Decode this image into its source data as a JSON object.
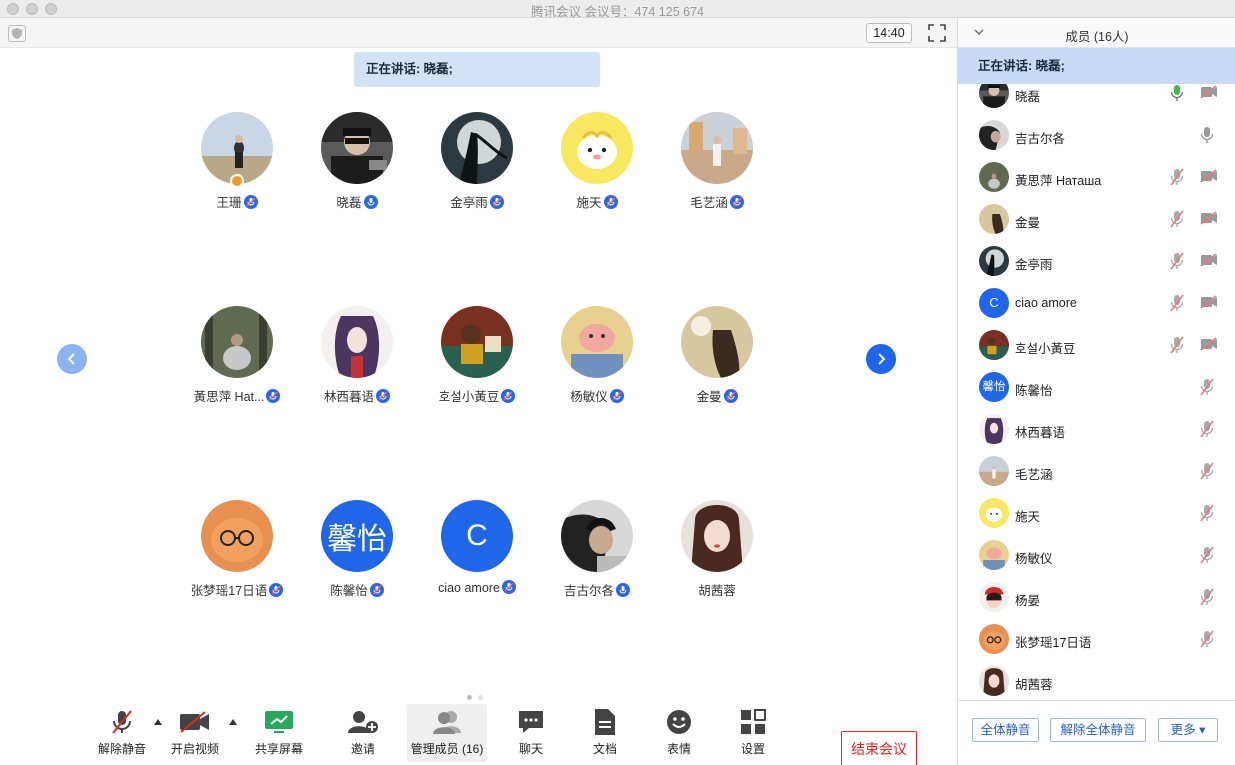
{
  "window": {
    "title": "腾讯会议 会议号：474 125 674"
  },
  "topbar": {
    "timer": "14:40"
  },
  "speaking": {
    "label": "正在讲话: 晓磊;"
  },
  "grid": {
    "participants": [
      {
        "name": "王珊",
        "host": true
      },
      {
        "name": "晓磊"
      },
      {
        "name": "金亭雨"
      },
      {
        "name": "施天"
      },
      {
        "name": "毛艺涵"
      },
      {
        "name": "黃思萍 Hat..."
      },
      {
        "name": "林西暮语"
      },
      {
        "name": "호설小黃豆"
      },
      {
        "name": "杨敏仪"
      },
      {
        "name": "金曼"
      },
      {
        "name": "张梦瑶17日语"
      },
      {
        "name": "陈馨怡",
        "initials": "馨怡"
      },
      {
        "name": "ciao amore",
        "initials": "C"
      },
      {
        "name": "吉古尔各"
      },
      {
        "name": "胡茜蓉"
      }
    ]
  },
  "toolbar": {
    "unmute": "解除静音",
    "start_video": "开启视频",
    "share_screen": "共享屏幕",
    "invite": "邀请",
    "manage_members": "管理成员 (16)",
    "chat": "聊天",
    "docs": "文档",
    "emoji": "表情",
    "settings": "设置",
    "end_meeting": "结束会议"
  },
  "panel": {
    "title": "成员 (16人)",
    "speaking": "正在讲话: 晓磊;",
    "members": [
      {
        "name": "晓磊",
        "mic": "on",
        "cam": "off"
      },
      {
        "name": "吉古尔各",
        "mic": "on-gray"
      },
      {
        "name": "黃思萍 Наташа",
        "mic": "muted",
        "cam": "off"
      },
      {
        "name": "金曼",
        "mic": "muted",
        "cam": "off"
      },
      {
        "name": "金亭雨",
        "mic": "muted",
        "cam": "off"
      },
      {
        "name": "ciao amore",
        "mic": "muted",
        "cam": "off",
        "initials": "C"
      },
      {
        "name": "호설小黃豆",
        "mic": "muted",
        "cam": "off"
      },
      {
        "name": "陈馨怡",
        "mic": "muted",
        "initials": "馨怡"
      },
      {
        "name": "林西暮语",
        "mic": "muted"
      },
      {
        "name": "毛艺涵",
        "mic": "muted"
      },
      {
        "name": "施天",
        "mic": "muted"
      },
      {
        "name": "杨敏仪",
        "mic": "muted"
      },
      {
        "name": "杨晏",
        "mic": "muted"
      },
      {
        "name": "张梦瑶17日语",
        "mic": "muted"
      },
      {
        "name": "胡茜蓉"
      }
    ],
    "mute_all": "全体静音",
    "unmute_all": "解除全体静音",
    "more": "更多 ▾"
  },
  "colors": {
    "accent": "#1f66e8",
    "banner": "#d2e3f8",
    "end_red": "#e02525",
    "muted_red": "#e5787a"
  }
}
